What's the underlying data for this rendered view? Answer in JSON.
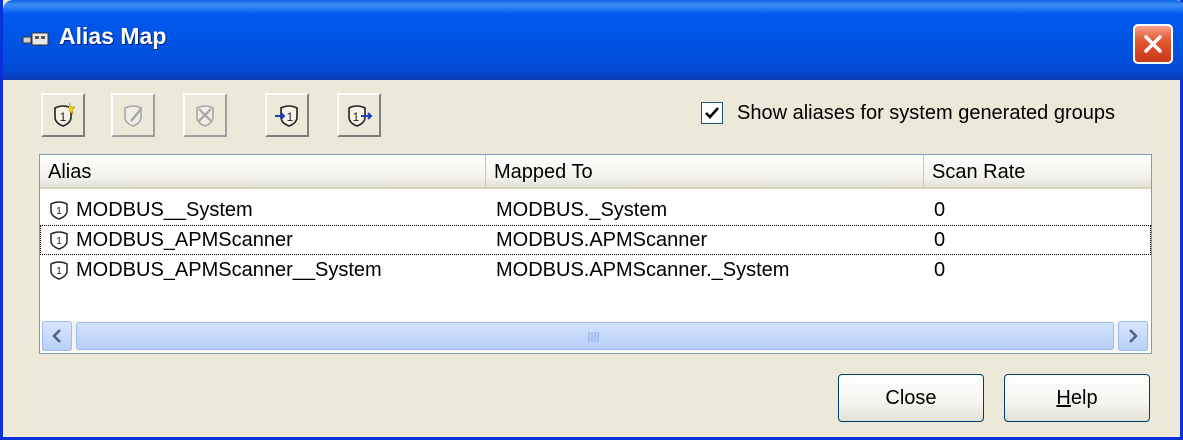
{
  "window": {
    "title": "Alias Map",
    "close_icon": "close-x-icon",
    "accent_color": "#0054e3",
    "close_color": "#d6401f"
  },
  "toolbar": {
    "buttons": [
      {
        "icon": "new-alias-icon",
        "enabled": true
      },
      {
        "icon": "edit-alias-icon",
        "enabled": false
      },
      {
        "icon": "delete-alias-icon",
        "enabled": false
      },
      {
        "icon": "import-alias-icon",
        "enabled": true
      },
      {
        "icon": "export-alias-icon",
        "enabled": true
      }
    ],
    "show_system_groups": {
      "label": "Show aliases for system generated groups",
      "checked": true
    }
  },
  "table": {
    "columns": [
      "Alias",
      "Mapped To",
      "Scan Rate"
    ],
    "rows": [
      {
        "icon": "alias-shield-icon",
        "alias": "MODBUS__System",
        "mapped_to": "MODBUS._System",
        "scan_rate": "0"
      },
      {
        "icon": "alias-shield-icon",
        "alias": "MODBUS_APMScanner",
        "mapped_to": "MODBUS.APMScanner",
        "scan_rate": "0"
      },
      {
        "icon": "alias-shield-icon",
        "alias": "MODBUS_APMScanner__System",
        "mapped_to": "MODBUS.APMScanner._System",
        "scan_rate": "0"
      }
    ],
    "focused_row": 1
  },
  "footer": {
    "close_label": "Close",
    "help_label_mnemonic": "H",
    "help_label_rest": "elp"
  }
}
